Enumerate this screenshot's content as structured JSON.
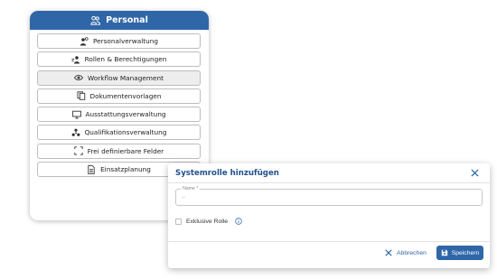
{
  "card": {
    "title": "Personal",
    "title_icon": "people-icon",
    "items": [
      {
        "label": "Personalverwaltung",
        "icon": "person-gear-icon"
      },
      {
        "label": "Rollen & Berechtigungen",
        "icon": "roles-icon"
      },
      {
        "label": "Workflow Management",
        "icon": "workflow-eye-icon",
        "active": true
      },
      {
        "label": "Dokumentenvorlagen",
        "icon": "documents-icon"
      },
      {
        "label": "Ausstattungsverwaltung",
        "icon": "monitor-icon"
      },
      {
        "label": "Qualifikationsverwaltung",
        "icon": "qualification-icon"
      },
      {
        "label": "Frei definierbare Felder",
        "icon": "fullscreen-corners-icon"
      },
      {
        "label": "Einsatzplanung",
        "icon": "document-list-icon"
      }
    ]
  },
  "dialog": {
    "title": "Systemrolle hinzufügen",
    "name_label": "Name *",
    "name_value": "--",
    "checkbox_label": "Exklusive Rolle",
    "cancel_label": "Abbrechen",
    "save_label": "Speichern"
  },
  "colors": {
    "primary": "#2f66a8",
    "title": "#1f4f8c"
  }
}
